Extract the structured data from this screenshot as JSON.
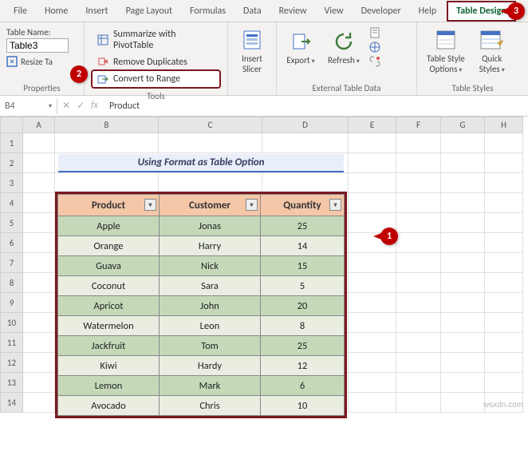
{
  "tabs": {
    "file": "File",
    "home": "Home",
    "insert": "Insert",
    "page_layout": "Page Layout",
    "formulas": "Formulas",
    "data": "Data",
    "review": "Review",
    "view": "View",
    "developer": "Developer",
    "help": "Help",
    "table_design": "Table Design"
  },
  "ribbon": {
    "properties": {
      "name_label": "Table Name:",
      "name_value": "Table3",
      "resize": "Resize Ta",
      "group_label": "Properties"
    },
    "tools": {
      "pivot": "Summarize with PivotTable",
      "dup": "Remove Duplicates",
      "range": "Convert to Range",
      "group_label": "Tools"
    },
    "slicer": {
      "line1": "Insert",
      "line2": "Slicer"
    },
    "export": "Export",
    "refresh": "Refresh",
    "ext": "External Table Data",
    "styleopt": {
      "line1": "Table Style",
      "line2": "Options"
    },
    "quick": {
      "line1": "Quick",
      "line2": "Styles"
    },
    "tablestyles": "Table Styles"
  },
  "callouts": {
    "c1": "1",
    "c2": "2",
    "c3": "3"
  },
  "formula": {
    "name_box": "B4",
    "fx": "fx",
    "value": "Product"
  },
  "cols": [
    "A",
    "B",
    "C",
    "D",
    "E",
    "F",
    "G",
    "H"
  ],
  "rows": [
    "1",
    "2",
    "3",
    "4",
    "5",
    "6",
    "7",
    "8",
    "9",
    "10",
    "11",
    "12",
    "13",
    "14"
  ],
  "title": "Using Format as Table Option",
  "headers": {
    "product": "Product",
    "customer": "Customer",
    "quantity": "Quantity"
  },
  "data": [
    {
      "p": "Apple",
      "c": "Jonas",
      "q": "25"
    },
    {
      "p": "Orange",
      "c": "Harry",
      "q": "14"
    },
    {
      "p": "Guava",
      "c": "Nick",
      "q": "15"
    },
    {
      "p": "Coconut",
      "c": "Sara",
      "q": "5"
    },
    {
      "p": "Apricot",
      "c": "John",
      "q": "20"
    },
    {
      "p": "Watermelon",
      "c": "Leon",
      "q": "8"
    },
    {
      "p": "Jackfruit",
      "c": "Tom",
      "q": "25"
    },
    {
      "p": "Kiwi",
      "c": "Hardy",
      "q": "12"
    },
    {
      "p": "Lemon",
      "c": "Mark",
      "q": "6"
    },
    {
      "p": "Avocado",
      "c": "Chris",
      "q": "10"
    }
  ],
  "watermark": "wsxdn.com"
}
